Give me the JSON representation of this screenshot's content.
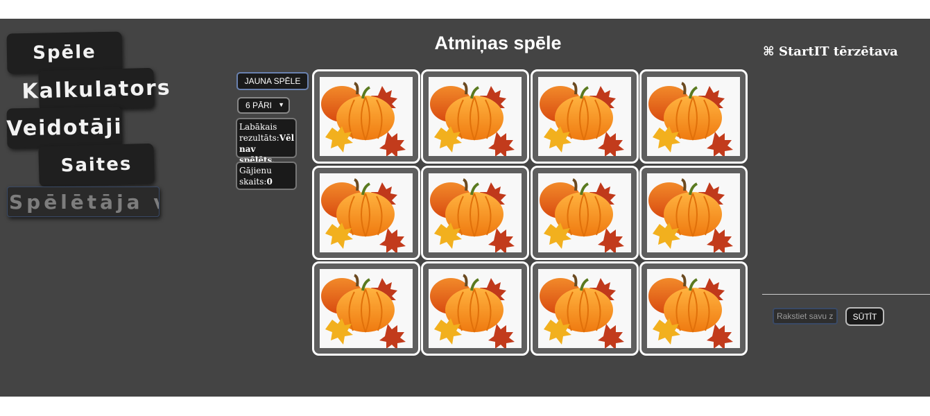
{
  "nav": {
    "items": [
      {
        "label": "Spēle"
      },
      {
        "label": "Kalkulators"
      },
      {
        "label": "Veidotāji"
      },
      {
        "label": "Saites"
      },
      {
        "label": "Spēlētāja v"
      }
    ]
  },
  "game": {
    "title": "Atmiņas spēle",
    "new_game_label": "JAUNA SPĒLE",
    "pairs_selected": "6 PĀRI",
    "best_label": "Labākais rezultāts:",
    "best_value": "Vēl nav spēlēts.",
    "moves_label": "Gājienu skaits:",
    "moves_value": "0",
    "card_count": 12,
    "card_icon": "pumpkin-icon"
  },
  "chat": {
    "title": "⌘ StartIT tērzētava",
    "input_placeholder": "Rakstiet savu z",
    "send_label": "SŪTĪT"
  },
  "colors": {
    "background": "#444444",
    "card_back": "#5e5e5e",
    "nav_button": "#1f1f1f"
  }
}
